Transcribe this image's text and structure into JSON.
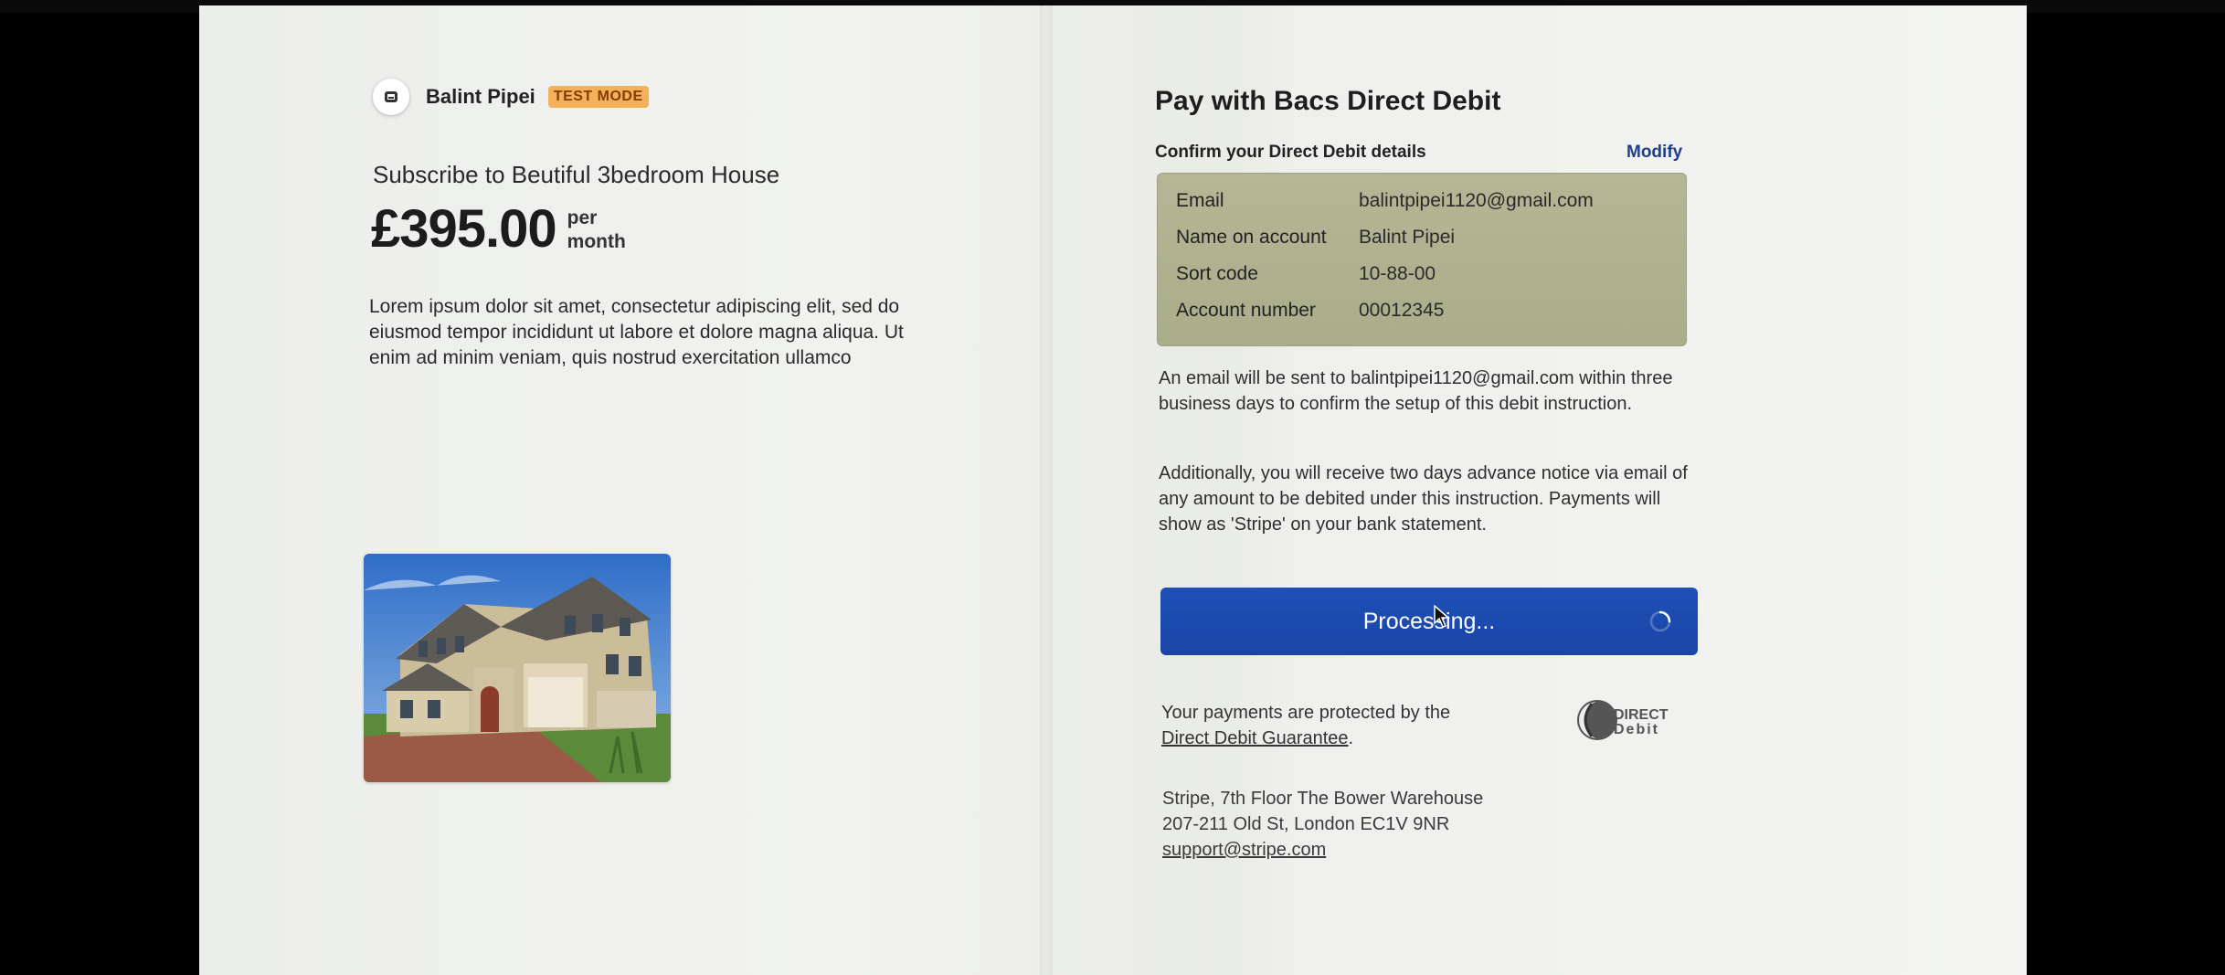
{
  "merchant": {
    "name": "Balint Pipei",
    "badge": "TEST MODE"
  },
  "product": {
    "subscribe_text": "Subscribe to Beutiful 3bedroom House",
    "price": "£395.00",
    "period_line1": "per",
    "period_line2": "month",
    "description": "Lorem ipsum dolor sit amet, consectetur adipiscing elit, sed do eiusmod tempor incididunt ut labore et dolore magna aliqua. Ut enim ad minim veniam, quis nostrud exercitation ullamco"
  },
  "payment": {
    "title": "Pay with Bacs Direct Debit",
    "confirm_label": "Confirm your Direct Debit details",
    "modify_label": "Modify",
    "details": [
      {
        "label": "Email",
        "value": "balintpipei1120@gmail.com"
      },
      {
        "label": "Name on account",
        "value": "Balint Pipei"
      },
      {
        "label": "Sort code",
        "value": "10-88-00"
      },
      {
        "label": "Account number",
        "value": "00012345"
      }
    ],
    "info_email": "An email will be sent to balintpipei1120@gmail.com within three business days to confirm the setup of this debit instruction.",
    "info_notice": "Additionally, you will receive two days advance notice via email of any amount to be debited under this instruction. Payments will show as 'Stripe' on your bank statement.",
    "button_label": "Processing...",
    "protected_text": "Your payments are protected by the",
    "guarantee_link": "Direct Debit Guarantee",
    "guarantee_suffix": ".",
    "dd_logo_line1": "DIRECT",
    "dd_logo_line2": "Debit"
  },
  "footer": {
    "address_line1": "Stripe, 7th Floor The Bower Warehouse",
    "address_line2": "207-211 Old St, London EC1V 9NR",
    "support_email": "support@stripe.com"
  },
  "colors": {
    "button": "#1e4fb7",
    "badge_bg": "#f2b15a",
    "details_bg": "#b0b290",
    "modify_link": "#1f3f8a"
  },
  "icons": [
    "merchant-logo-icon",
    "spinner-icon",
    "mouse-cursor-icon",
    "direct-debit-logo"
  ]
}
